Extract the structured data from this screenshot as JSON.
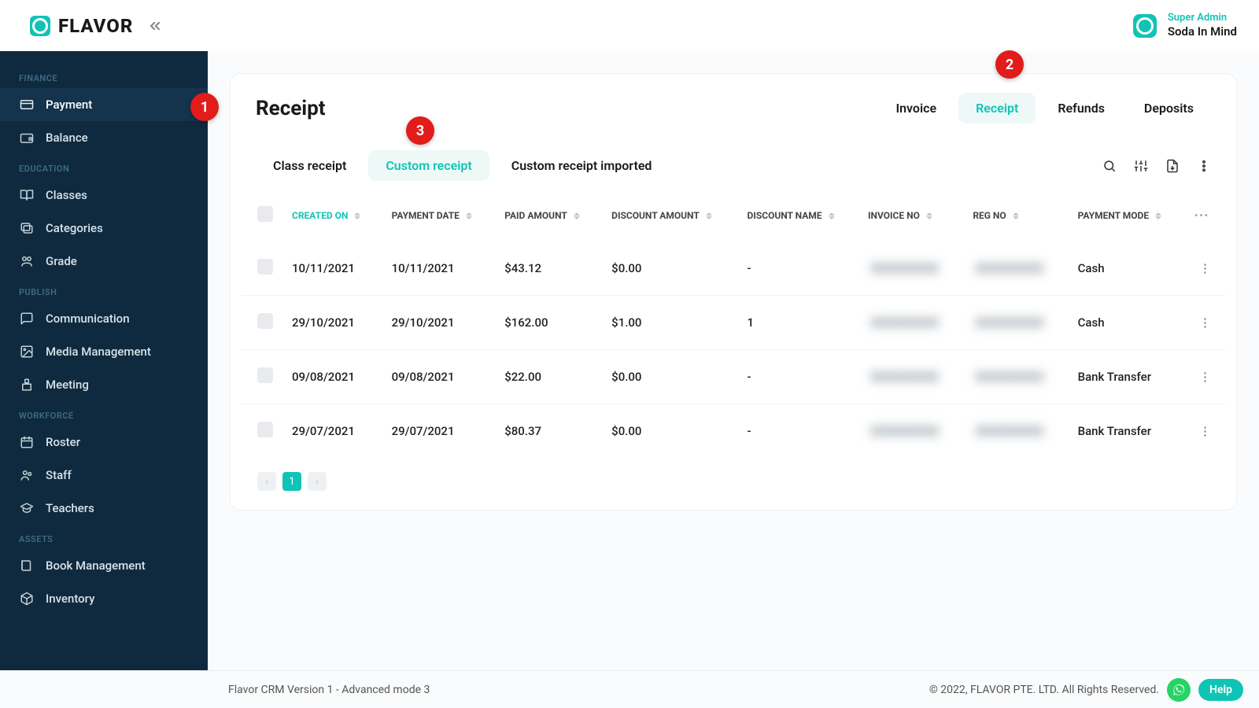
{
  "brand": {
    "name": "FLAVOR"
  },
  "user": {
    "role": "Super Admin",
    "name": "Soda In Mind"
  },
  "sidebar": {
    "sections": [
      {
        "heading": "FINANCE",
        "items": [
          {
            "id": "payment",
            "label": "Payment",
            "icon": "credit-card",
            "active": true
          },
          {
            "id": "balance",
            "label": "Balance",
            "icon": "wallet"
          }
        ]
      },
      {
        "heading": "EDUCATION",
        "items": [
          {
            "id": "classes",
            "label": "Classes",
            "icon": "book-open"
          },
          {
            "id": "categories",
            "label": "Categories",
            "icon": "layers"
          },
          {
            "id": "grade",
            "label": "Grade",
            "icon": "grade"
          }
        ]
      },
      {
        "heading": "PUBLISH",
        "items": [
          {
            "id": "communication",
            "label": "Communication",
            "icon": "message"
          },
          {
            "id": "media",
            "label": "Media Management",
            "icon": "image"
          },
          {
            "id": "meeting",
            "label": "Meeting",
            "icon": "podium"
          }
        ]
      },
      {
        "heading": "WORKFORCE",
        "items": [
          {
            "id": "roster",
            "label": "Roster",
            "icon": "calendar"
          },
          {
            "id": "staff",
            "label": "Staff",
            "icon": "users"
          },
          {
            "id": "teachers",
            "label": "Teachers",
            "icon": "graduation"
          }
        ]
      },
      {
        "heading": "ASSETS",
        "items": [
          {
            "id": "book-mgmt",
            "label": "Book Management",
            "icon": "book"
          },
          {
            "id": "inventory",
            "label": "Inventory",
            "icon": "box"
          }
        ]
      }
    ]
  },
  "page": {
    "title": "Receipt",
    "top_tabs": [
      {
        "id": "invoice",
        "label": "Invoice"
      },
      {
        "id": "receipt",
        "label": "Receipt",
        "active": true
      },
      {
        "id": "refunds",
        "label": "Refunds"
      },
      {
        "id": "deposits",
        "label": "Deposits"
      }
    ],
    "sub_tabs": [
      {
        "id": "class-receipt",
        "label": "Class receipt"
      },
      {
        "id": "custom-receipt",
        "label": "Custom receipt",
        "active": true
      },
      {
        "id": "custom-receipt-imported",
        "label": "Custom receipt imported"
      }
    ]
  },
  "table": {
    "columns": [
      {
        "key": "created_on",
        "label": "CREATED ON",
        "sortable": true,
        "active_sort": true
      },
      {
        "key": "payment_date",
        "label": "PAYMENT DATE",
        "sortable": true
      },
      {
        "key": "paid_amount",
        "label": "PAID AMOUNT",
        "sortable": true
      },
      {
        "key": "discount_amount",
        "label": "DISCOUNT AMOUNT",
        "sortable": true
      },
      {
        "key": "discount_name",
        "label": "DISCOUNT NAME",
        "sortable": true
      },
      {
        "key": "invoice_no",
        "label": "INVOICE NO",
        "sortable": true
      },
      {
        "key": "reg_no",
        "label": "REG NO",
        "sortable": true
      },
      {
        "key": "payment_mode",
        "label": "PAYMENT MODE",
        "sortable": true
      }
    ],
    "rows": [
      {
        "created_on": "10/11/2021",
        "payment_date": "10/11/2021",
        "paid_amount": "$43.12",
        "discount_amount": "$0.00",
        "discount_name": "-",
        "invoice_no": "REDACTED",
        "reg_no": "REDACTED",
        "payment_mode": "Cash"
      },
      {
        "created_on": "29/10/2021",
        "payment_date": "29/10/2021",
        "paid_amount": "$162.00",
        "discount_amount": "$1.00",
        "discount_name": "1",
        "invoice_no": "REDACTED",
        "reg_no": "REDACTED",
        "payment_mode": "Cash"
      },
      {
        "created_on": "09/08/2021",
        "payment_date": "09/08/2021",
        "paid_amount": "$22.00",
        "discount_amount": "$0.00",
        "discount_name": "-",
        "invoice_no": "REDACTED",
        "reg_no": "REDACTED",
        "payment_mode": "Bank Transfer"
      },
      {
        "created_on": "29/07/2021",
        "payment_date": "29/07/2021",
        "paid_amount": "$80.37",
        "discount_amount": "$0.00",
        "discount_name": "-",
        "invoice_no": "REDACTED",
        "reg_no": "REDACTED",
        "payment_mode": "Bank Transfer"
      }
    ],
    "pagination": {
      "current": "1"
    }
  },
  "footer": {
    "version": "Flavor CRM Version 1 - Advanced mode 3",
    "copyright": "© 2022, FLAVOR PTE. LTD. All Rights Reserved.",
    "help_label": "Help"
  },
  "callouts": {
    "c1": "1",
    "c2": "2",
    "c3": "3"
  }
}
